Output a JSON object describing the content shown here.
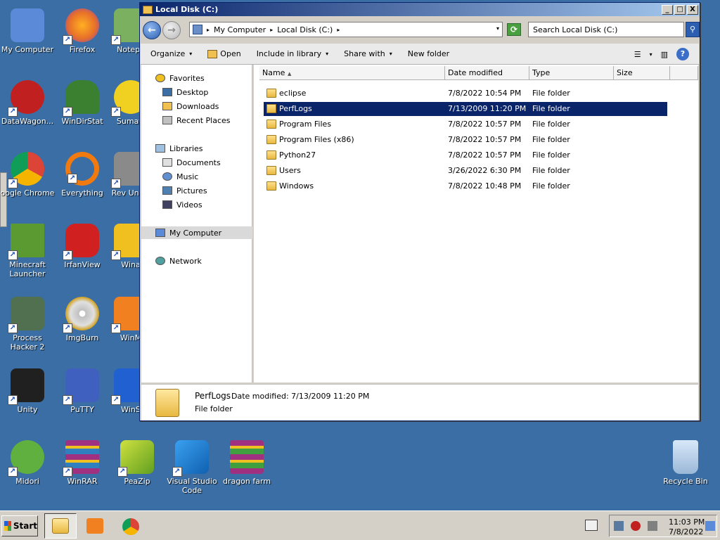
{
  "desktop": {
    "icons": [
      {
        "label": "My Computer",
        "color": "#5a8ad8"
      },
      {
        "label": "Firefox",
        "color": "#e8702a"
      },
      {
        "label": "Notepa",
        "color": "#7ab060"
      },
      {
        "label": "DataWagon...",
        "color": "#c02020"
      },
      {
        "label": "WinDirStat",
        "color": "#3a8030"
      },
      {
        "label": "Sumatr",
        "color": "#f0d020"
      },
      {
        "label": "oogle Chrome",
        "color": "#4285f4"
      },
      {
        "label": "Everything",
        "color": "#f07a10"
      },
      {
        "label": "Rev Unins",
        "color": "#8a8a8a"
      },
      {
        "label": "Minecraft Launcher",
        "color": "#5a9a30"
      },
      {
        "label": "IrfanView",
        "color": "#d02020"
      },
      {
        "label": "Wina",
        "color": "#f0c020"
      },
      {
        "label": "Process Hacker 2",
        "color": "#507050"
      },
      {
        "label": "ImgBurn",
        "color": "#d0a020"
      },
      {
        "label": "WinM",
        "color": "#f08020"
      },
      {
        "label": "Unity",
        "color": "#202020"
      },
      {
        "label": "PuTTY",
        "color": "#4060c0"
      },
      {
        "label": "WinS",
        "color": "#2060d0"
      },
      {
        "label": "Midori",
        "color": "#60b040"
      },
      {
        "label": "WinRAR",
        "color": "#a03080"
      },
      {
        "label": "PeaZip",
        "color": "#90c020"
      },
      {
        "label": "Visual Studio Code",
        "color": "#2a80d0"
      },
      {
        "label": "dragon farm",
        "color": "#a03080"
      },
      {
        "label": "Recycle Bin",
        "color": "#9ab8d8"
      }
    ]
  },
  "window": {
    "title": "Local Disk (C:)",
    "minimize_label": "_",
    "maximize_label": "□",
    "close_label": "X",
    "back_label": "←",
    "forward_label": "→",
    "address": {
      "crumbs": [
        "My Computer",
        "Local Disk (C:)"
      ],
      "separator": "▸",
      "dropdown": "▾"
    },
    "refresh_label": "⟳",
    "search_placeholder": "Search Local Disk (C:)",
    "search_icon": "⚲",
    "toolbar": {
      "organize": "Organize",
      "open": "Open",
      "include_in_library": "Include in library",
      "share_with": "Share with",
      "new_folder": "New folder",
      "caret": "▾",
      "views_icon": "☰",
      "preview_icon": "▥",
      "help": "?"
    },
    "nav": {
      "favorites": "Favorites",
      "desktop": "Desktop",
      "downloads": "Downloads",
      "recent_places": "Recent Places",
      "libraries": "Libraries",
      "documents": "Documents",
      "music": "Music",
      "pictures": "Pictures",
      "videos": "Videos",
      "my_computer": "My Computer",
      "network": "Network"
    },
    "columns": {
      "name": "Name",
      "date_modified": "Date modified",
      "type": "Type",
      "size": "Size"
    },
    "files": [
      {
        "name": "eclipse",
        "date": "7/8/2022 10:54 PM",
        "type": "File folder"
      },
      {
        "name": "PerfLogs",
        "date": "7/13/2009 11:20 PM",
        "type": "File folder"
      },
      {
        "name": "Program Files",
        "date": "7/8/2022 10:57 PM",
        "type": "File folder"
      },
      {
        "name": "Program Files (x86)",
        "date": "7/8/2022 10:57 PM",
        "type": "File folder"
      },
      {
        "name": "Python27",
        "date": "7/8/2022 10:57 PM",
        "type": "File folder"
      },
      {
        "name": "Users",
        "date": "3/26/2022 6:30 PM",
        "type": "File folder"
      },
      {
        "name": "Windows",
        "date": "7/8/2022 10:48 PM",
        "type": "File folder"
      }
    ],
    "details": {
      "name": "PerfLogs",
      "date_modified": "Date modified: 7/13/2009 11:20 PM",
      "type": "File folder"
    }
  },
  "taskbar": {
    "start": "Start",
    "clock_time": "11:03 PM",
    "clock_date": "7/8/2022"
  },
  "colors": {
    "selection": "#0a246a",
    "desktop": "#3a6ea5"
  }
}
